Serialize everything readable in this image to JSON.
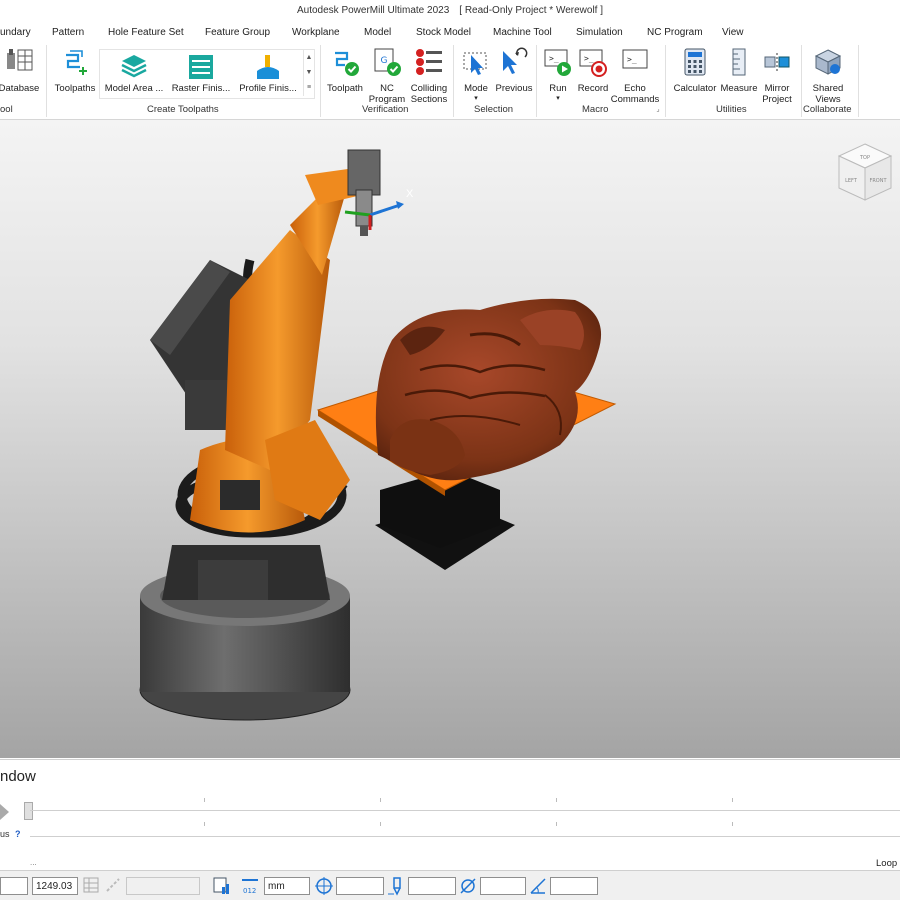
{
  "window": {
    "title": "Autodesk PowerMill Ultimate 2023",
    "project": "[ Read-Only Project * Werewolf ]"
  },
  "menu_tabs": [
    "undary",
    "Pattern",
    "Hole Feature Set",
    "Feature Group",
    "Workplane",
    "Model",
    "Stock Model",
    "Machine Tool",
    "Simulation",
    "NC Program",
    "View"
  ],
  "ribbon": {
    "groups": {
      "tool": "ool",
      "create_toolpaths": "Create Toolpaths",
      "verification": "Verification",
      "selection": "Selection",
      "macro": "Macro",
      "utilities": "Utilities",
      "collaborate": "Collaborate"
    },
    "buttons": {
      "database": "Database",
      "toolpaths": "Toolpaths",
      "model_area": "Model Area ...",
      "raster_finishing": "Raster Finis...",
      "profile_finishing": "Profile Finis...",
      "toolpath": "Toolpath",
      "nc_program": "NC\nProgram",
      "colliding_sections": "Colliding\nSections",
      "mode": "Mode",
      "previous": "Previous",
      "run": "Run",
      "record": "Record",
      "echo_commands": "Echo\nCommands",
      "calculator": "Calculator",
      "measure": "Measure",
      "mirror_project": "Mirror\nProject",
      "shared_views": "Shared\nViews"
    }
  },
  "viewport": {
    "axis_label": "X",
    "viewcube": {
      "top": "TOP",
      "left": "LEFT",
      "front": "FRONT"
    }
  },
  "simulation": {
    "title": "ndow",
    "status_label": "us",
    "help": "?",
    "loop": "Loop",
    "ellipsis": "..."
  },
  "statusbar": {
    "value1": "",
    "value2": "1249.03",
    "unit": "mm",
    "field_a": "",
    "field_b": "",
    "field_c": "",
    "field_d": ""
  },
  "colors": {
    "robot_orange": "#f08a1c",
    "workpiece_brown": "#8a3618",
    "table_orange": "#ff7f14",
    "accent_blue": "#1e74d4"
  }
}
